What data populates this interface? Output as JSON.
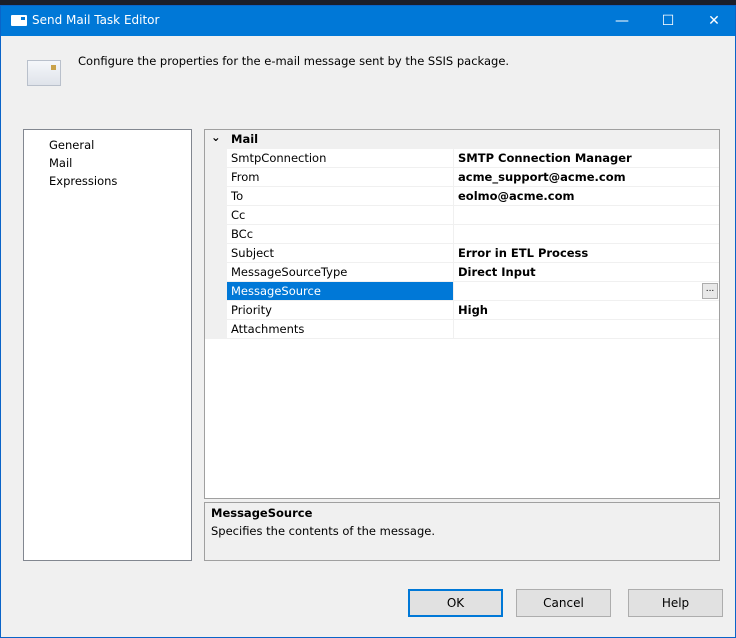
{
  "window": {
    "title": "Send Mail Task Editor",
    "minimize": "—",
    "maximize": "☐",
    "close": "✕"
  },
  "header": {
    "text": "Configure the properties for the e-mail message sent by the SSIS package."
  },
  "nav": {
    "items": [
      {
        "label": "General"
      },
      {
        "label": "Mail"
      },
      {
        "label": "Expressions"
      }
    ]
  },
  "grid": {
    "category": "Mail",
    "chevron": "⌄",
    "rows": [
      {
        "name": "SmtpConnection",
        "value": "SMTP Connection Manager"
      },
      {
        "name": "From",
        "value": "acme_support@acme.com"
      },
      {
        "name": "To",
        "value": "eolmo@acme.com"
      },
      {
        "name": "Cc",
        "value": ""
      },
      {
        "name": "BCc",
        "value": ""
      },
      {
        "name": "Subject",
        "value": "Error in ETL Process"
      },
      {
        "name": "MessageSourceType",
        "value": "Direct Input"
      },
      {
        "name": "MessageSource",
        "value": ""
      },
      {
        "name": "Priority",
        "value": "High"
      },
      {
        "name": "Attachments",
        "value": ""
      }
    ],
    "ellipsis": "..."
  },
  "description": {
    "title": "MessageSource",
    "text": "Specifies the contents of the message."
  },
  "buttons": {
    "ok": "OK",
    "cancel": "Cancel",
    "help": "Help"
  }
}
